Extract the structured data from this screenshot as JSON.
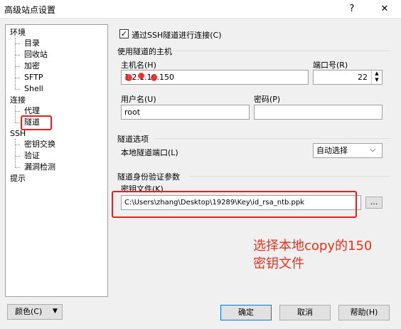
{
  "window": {
    "title": "高级站点设置",
    "help_glyph": "?",
    "close_glyph": "✕"
  },
  "tree": {
    "env": "环境",
    "directory": "目录",
    "recycle": "回收站",
    "encryption": "加密",
    "sftp": "SFTP",
    "shell": "Shell",
    "connection": "连接",
    "proxy": "代理",
    "tunnel": "隧道",
    "ssh": "SSH",
    "key_exchange": "密钥交换",
    "auth": "验证",
    "bug_detect": "漏洞检测",
    "notes": "提示"
  },
  "tunnel_checkbox": {
    "label": "通过SSH隧道进行连接(C)",
    "checked": true,
    "mark": "✓"
  },
  "host_group": {
    "title": "使用隧道的主机",
    "host_label": "主机名(H)",
    "host_value": "1.2.1.10.150",
    "port_label": "端口号(R)",
    "port_value": "22",
    "user_label": "用户名(U)",
    "user_value": "root",
    "password_label": "密码(P)",
    "password_value": ""
  },
  "tunnel_options": {
    "title": "隧道选项",
    "local_port_label": "本地隧道端口(L)",
    "local_port_value": "自动选择"
  },
  "auth_params": {
    "title": "隧道身份验证参数",
    "key_file_label": "密钥文件(K)",
    "key_file_value": "C:\\Users\\zhang\\Desktop\\19289\\Key\\id_rsa_ntb.ppk",
    "browse_label": "..."
  },
  "annotation": {
    "line1": "选择本地copy的150",
    "line2": "密钥文件"
  },
  "buttons": {
    "color": "颜色(C)",
    "ok": "确定",
    "cancel": "取消",
    "help": "帮助(H)"
  },
  "icons": {
    "spin_up": "▲",
    "spin_down": "▼",
    "dropdown": "⌵",
    "color_dropdown": "▼"
  },
  "colors": {
    "annotation_red": "#ee1d1d",
    "primary_button_border": "#0078d7"
  }
}
